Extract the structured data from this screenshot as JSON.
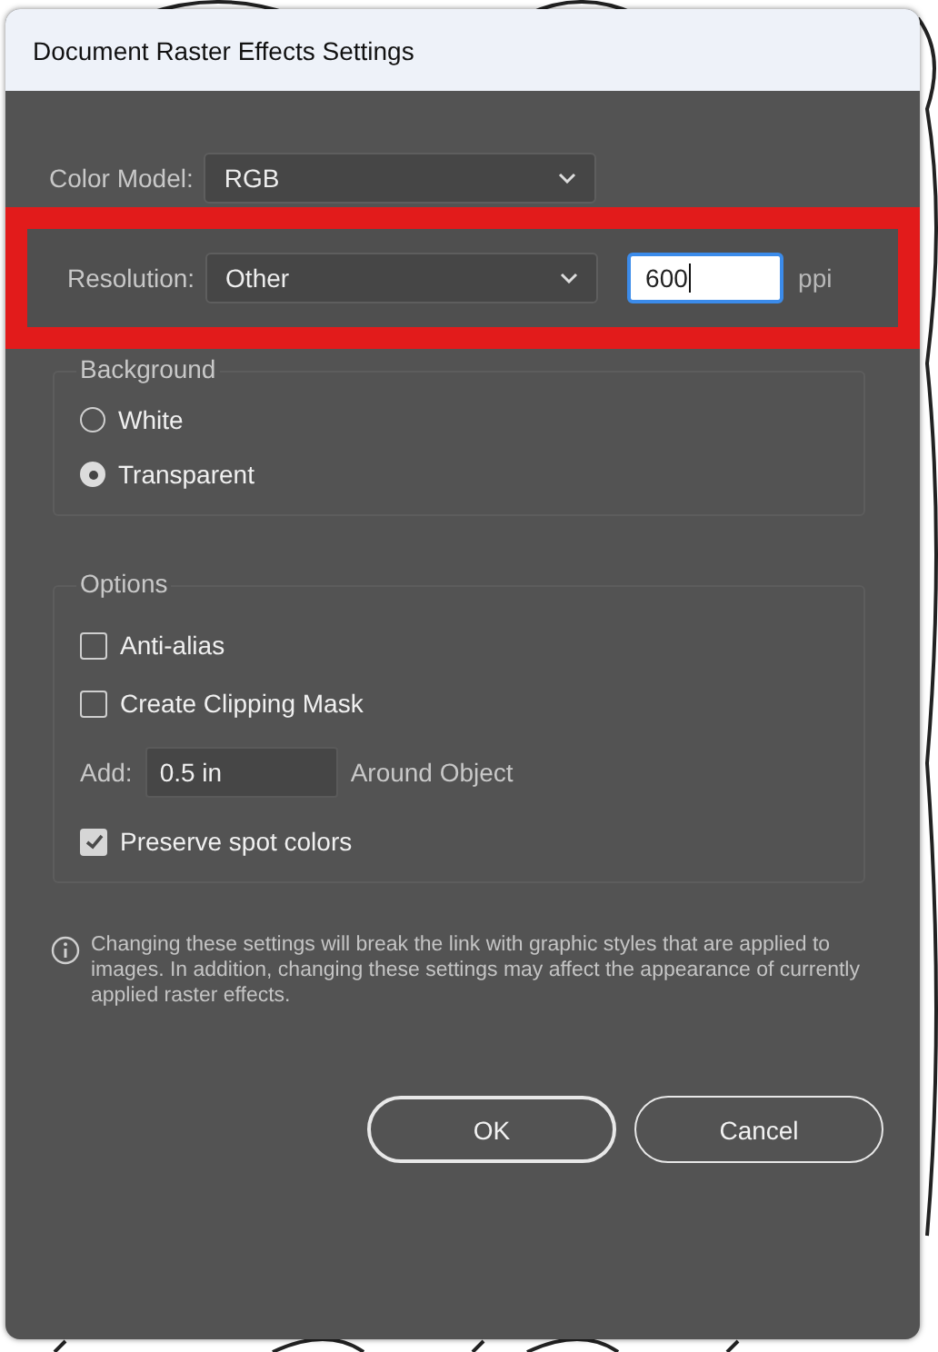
{
  "window": {
    "title": "Document Raster Effects Settings"
  },
  "color_model": {
    "label": "Color Model:",
    "value": "RGB"
  },
  "resolution": {
    "label": "Resolution:",
    "value": "Other",
    "amount": "600",
    "unit": "ppi",
    "focused": true
  },
  "background": {
    "title": "Background",
    "options": [
      {
        "label": "White",
        "selected": false
      },
      {
        "label": "Transparent",
        "selected": true
      }
    ]
  },
  "options": {
    "title": "Options",
    "items": [
      {
        "kind": "checkbox",
        "label": "Anti-alias",
        "checked": false
      },
      {
        "kind": "checkbox",
        "label": "Create Clipping Mask",
        "checked": false
      },
      {
        "kind": "field",
        "label": "Add:",
        "value": "0.5 in",
        "suffix": "Around Object"
      },
      {
        "kind": "checkbox",
        "label": "Preserve spot colors",
        "checked": true
      }
    ]
  },
  "note": "Changing these settings will break the link with graphic styles that are applied to images. In addition, changing these settings may affect the appearance of currently applied raster effects.",
  "buttons": [
    {
      "label": "OK",
      "default": true
    },
    {
      "label": "Cancel",
      "default": false
    }
  ]
}
